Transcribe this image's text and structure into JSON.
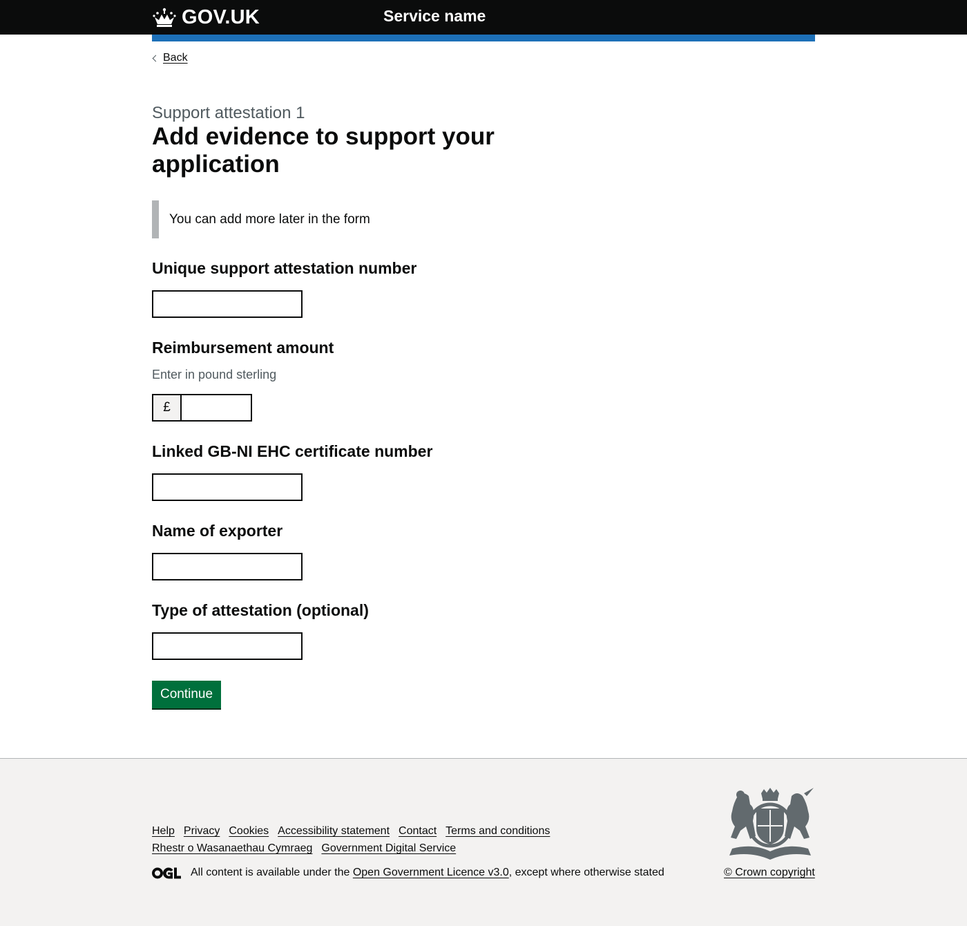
{
  "header": {
    "logo_text": "GOV.UK",
    "service_name": "Service name"
  },
  "back_link": "Back",
  "caption": "Support attestation 1",
  "title": "Add evidence to support your application",
  "inset_text": "You can add more later in the form",
  "form": {
    "attestation_number": {
      "label": "Unique support attestation number",
      "value": ""
    },
    "reimbursement": {
      "label": "Reimbursement amount",
      "hint": "Enter in pound sterling",
      "prefix": "£",
      "value": ""
    },
    "certificate_number": {
      "label": "Linked GB-NI EHC certificate number",
      "value": ""
    },
    "exporter_name": {
      "label": "Name of exporter",
      "value": ""
    },
    "attestation_type": {
      "label": "Type of attestation (optional)",
      "value": ""
    },
    "continue_label": "Continue"
  },
  "footer": {
    "links": [
      "Help",
      "Privacy",
      "Cookies",
      "Accessibility statement",
      "Contact",
      "Terms and conditions",
      "Rhestr o Wasanaethau Cymraeg",
      "Government Digital Service"
    ],
    "licence_prefix": "All content is available under the",
    "licence_link": "Open Government Licence v3.0",
    "licence_suffix": ", except where otherwise stated",
    "copyright": "© Crown copyright"
  },
  "colors": {
    "header_bg": "#0b0c0c",
    "header_accent": "#1d70b8",
    "button": "#00703c",
    "footer_bg": "#f3f2f1"
  }
}
